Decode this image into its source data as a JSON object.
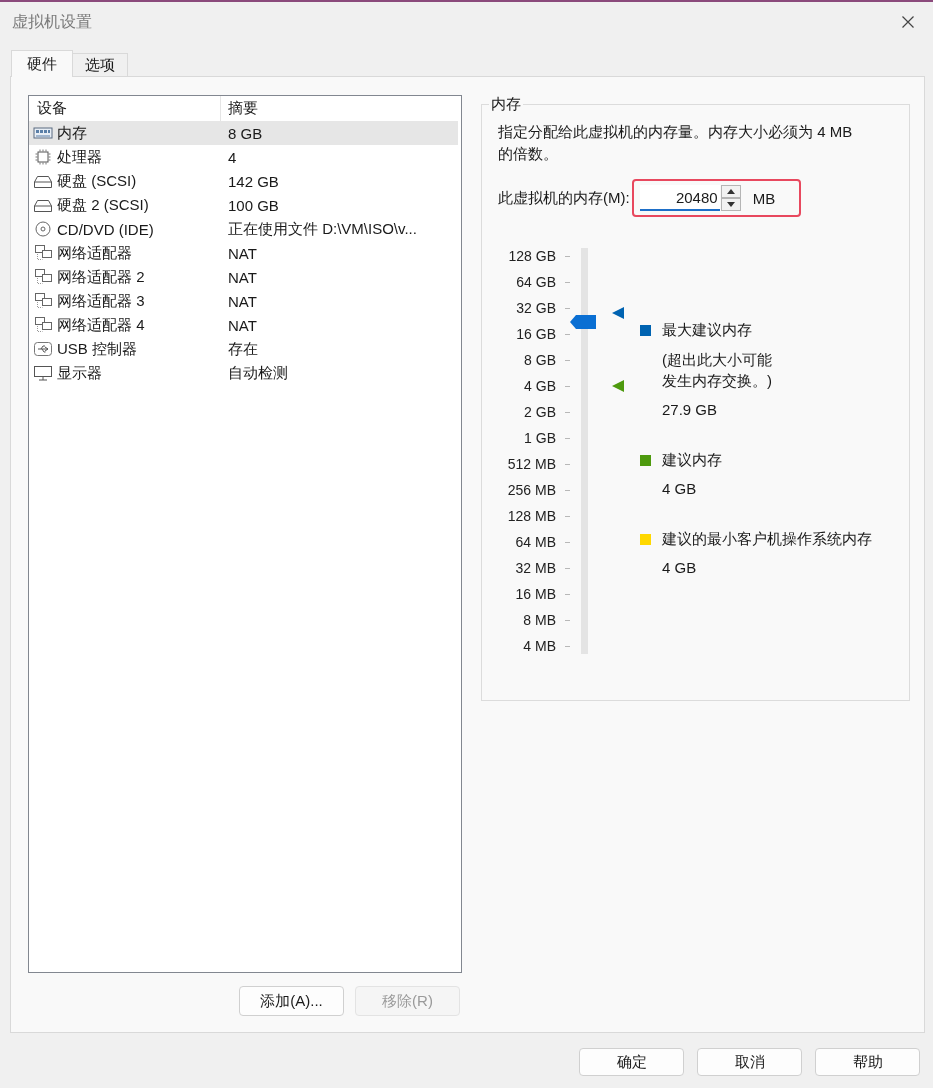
{
  "window": {
    "title": "虚拟机设置"
  },
  "tabs": [
    {
      "label": "硬件",
      "selected": true
    },
    {
      "label": "选项",
      "selected": false
    }
  ],
  "device_list": {
    "columns": [
      "设备",
      "摘要"
    ],
    "rows": [
      {
        "kind": "memory",
        "device": "内存",
        "summary": "8 GB",
        "selected": true
      },
      {
        "kind": "cpu",
        "device": "处理器",
        "summary": "4",
        "selected": false
      },
      {
        "kind": "disk",
        "device": "硬盘 (SCSI)",
        "summary": "142 GB",
        "selected": false
      },
      {
        "kind": "disk",
        "device": "硬盘 2 (SCSI)",
        "summary": "100 GB",
        "selected": false
      },
      {
        "kind": "cdrom",
        "device": "CD/DVD (IDE)",
        "summary": "正在使用文件 D:\\VM\\ISO\\v...",
        "selected": false
      },
      {
        "kind": "network",
        "device": "网络适配器",
        "summary": "NAT",
        "selected": false
      },
      {
        "kind": "network",
        "device": "网络适配器 2",
        "summary": "NAT",
        "selected": false
      },
      {
        "kind": "network",
        "device": "网络适配器 3",
        "summary": "NAT",
        "selected": false
      },
      {
        "kind": "network",
        "device": "网络适配器 4",
        "summary": "NAT",
        "selected": false
      },
      {
        "kind": "usb",
        "device": "USB 控制器",
        "summary": "存在",
        "selected": false
      },
      {
        "kind": "display",
        "device": "显示器",
        "summary": "自动检测",
        "selected": false
      }
    ]
  },
  "list_buttons": [
    {
      "label": "添加(A)...",
      "disabled": false
    },
    {
      "label": "移除(R)",
      "disabled": true
    }
  ],
  "memory": {
    "title": "内存",
    "description": "指定分配给此虚拟机的内存量。内存大小必须为 4 MB 的倍数。",
    "field": {
      "label": "此虚拟机的内存(M):",
      "value": "20480",
      "unit": "MB",
      "highlighted": true
    },
    "slider": {
      "ticks": [
        "128 GB",
        "64 GB",
        "32 GB",
        "16 GB",
        "8 GB",
        "4 GB",
        "2 GB",
        "1 GB",
        "512 MB",
        "256 MB",
        "128 MB",
        "64 MB",
        "32 MB",
        "16 MB",
        "8 MB",
        "4 MB"
      ],
      "level": 0.83,
      "markers": [
        {
          "level": 0.853,
          "color": "#0063b1"
        },
        {
          "level": 0.667,
          "color": "#4e9a0e"
        }
      ]
    },
    "legend": [
      {
        "label": "最大建议内存",
        "note": "(超出此大小可能发生内存交换。)",
        "value": "27.9 GB",
        "color": "#0063b1"
      },
      {
        "label": "建议内存",
        "value": "4 GB",
        "color": "#4e9a0e"
      },
      {
        "label": "建议的最小客户机操作系统内存",
        "value": "4 GB",
        "color": "#ffd800"
      }
    ]
  },
  "dialog_buttons": [
    "确定",
    "取消",
    "帮助"
  ]
}
